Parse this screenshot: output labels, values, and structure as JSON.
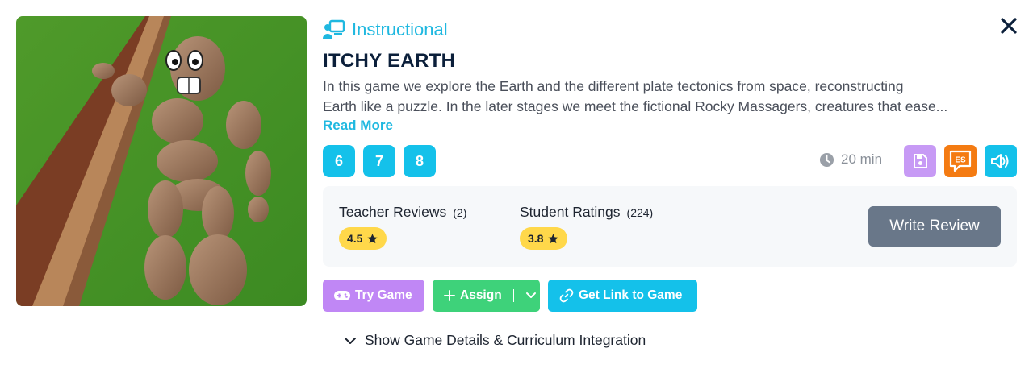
{
  "game": {
    "category": "Instructional",
    "title": "ITCHY EARTH",
    "description_line1": "In this game we explore the Earth and the different plate tectonics from space, reconstructing",
    "description_line2": "Earth like a puzzle. In the later stages we meet the fictional Rocky Massagers, creatures that ease...",
    "read_more": "Read More",
    "grades": [
      "6",
      "7",
      "8"
    ],
    "duration": "20 min",
    "language_badge": "ES"
  },
  "reviews": {
    "teacher_label": "Teacher Reviews",
    "teacher_count": "(2)",
    "teacher_rating": "4.5",
    "student_label": "Student Ratings",
    "student_count": "(224)",
    "student_rating": "3.8",
    "write_review": "Write Review"
  },
  "actions": {
    "try_game": "Try Game",
    "assign": "Assign",
    "get_link": "Get Link to Game"
  },
  "details_toggle": "Show Game Details & Curriculum Integration",
  "colors": {
    "accent": "#14c1ea",
    "title": "#0b1f3a",
    "try_game": "#c087f5",
    "assign": "#3ed27a",
    "save": "#c79af5",
    "language": "#f47b12",
    "write_review": "#697789",
    "rating_badge": "#ffd84a"
  },
  "icons": {
    "category": "presentation-board-icon",
    "close": "close-icon",
    "clock": "clock-icon",
    "save": "floppy-disk-icon",
    "language": "speech-bubble-icon",
    "audio": "speaker-icon",
    "star": "star-icon",
    "gamepad": "gamepad-icon",
    "plus": "plus-icon",
    "chevron": "chevron-down-icon",
    "link": "link-icon"
  }
}
